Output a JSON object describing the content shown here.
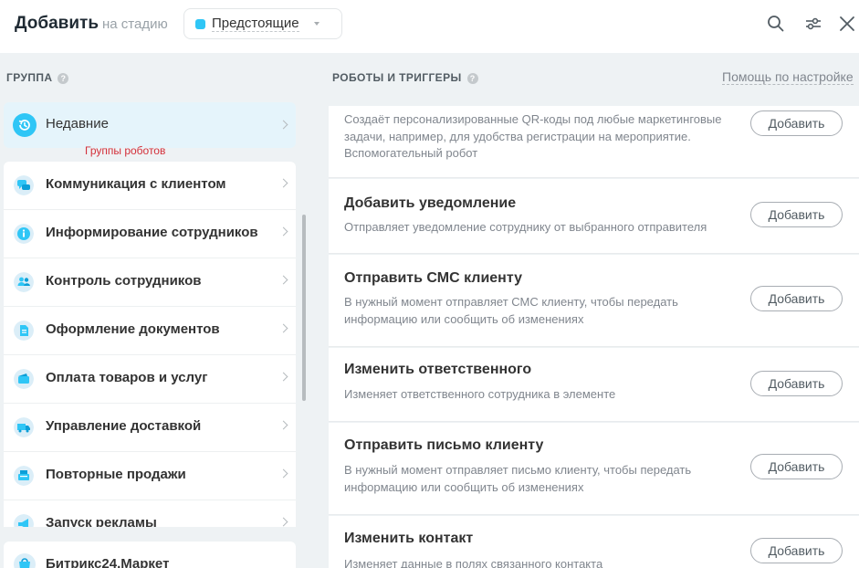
{
  "header": {
    "title": "Добавить",
    "subtitle": "на стадию",
    "stage_label": "Предстоящие",
    "stage_color": "#2fc6f6",
    "icons": [
      "search-icon",
      "settings-sliders-icon",
      "close-icon"
    ]
  },
  "groups_panel": {
    "heading": "ГРУППА",
    "help_mark": "?",
    "recent": {
      "label": "Недавние",
      "icon": "history-icon"
    },
    "tooltip": "Группы роботов",
    "items": [
      {
        "label": "Коммуникация с клиентом",
        "icon": "chat-icon"
      },
      {
        "label": "Информирование сотрудников",
        "icon": "info-icon"
      },
      {
        "label": "Контроль сотрудников",
        "icon": "people-icon"
      },
      {
        "label": "Оформление документов",
        "icon": "document-icon"
      },
      {
        "label": "Оплата товаров и услуг",
        "icon": "wallet-icon"
      },
      {
        "label": "Управление доставкой",
        "icon": "truck-icon"
      },
      {
        "label": "Повторные продажи",
        "icon": "cash-register-icon"
      },
      {
        "label": "Запуск рекламы",
        "icon": "megaphone-icon"
      }
    ],
    "market": {
      "label": "Битрикс24.Маркет",
      "icon": "market-icon"
    }
  },
  "robots_panel": {
    "heading": "РОБОТЫ И ТРИГГЕРЫ",
    "help_mark": "?",
    "help_link": "Помощь по настройке",
    "add_label": "Добавить",
    "robots": [
      {
        "title": "",
        "description": "Создаёт персонализированные QR-коды под любые маркетинговые задачи, например, для удобства регистрации на мероприятие. Вспомогательный робот"
      },
      {
        "title": "Добавить уведомление",
        "description": "Отправляет уведомление сотруднику от выбранного отправителя"
      },
      {
        "title": "Отправить СМС клиенту",
        "description": "В нужный момент отправляет СМС клиенту, чтобы передать информацию или сообщить об изменениях"
      },
      {
        "title": "Изменить ответственного",
        "description": "Изменяет ответственного сотрудника в элементе"
      },
      {
        "title": "Отправить письмо клиенту",
        "description": "В нужный момент отправляет письмо клиенту, чтобы передать информацию или сообщить об изменениях"
      },
      {
        "title": "Изменить контакт",
        "description": "Изменяет данные в полях связанного контакта"
      }
    ]
  }
}
